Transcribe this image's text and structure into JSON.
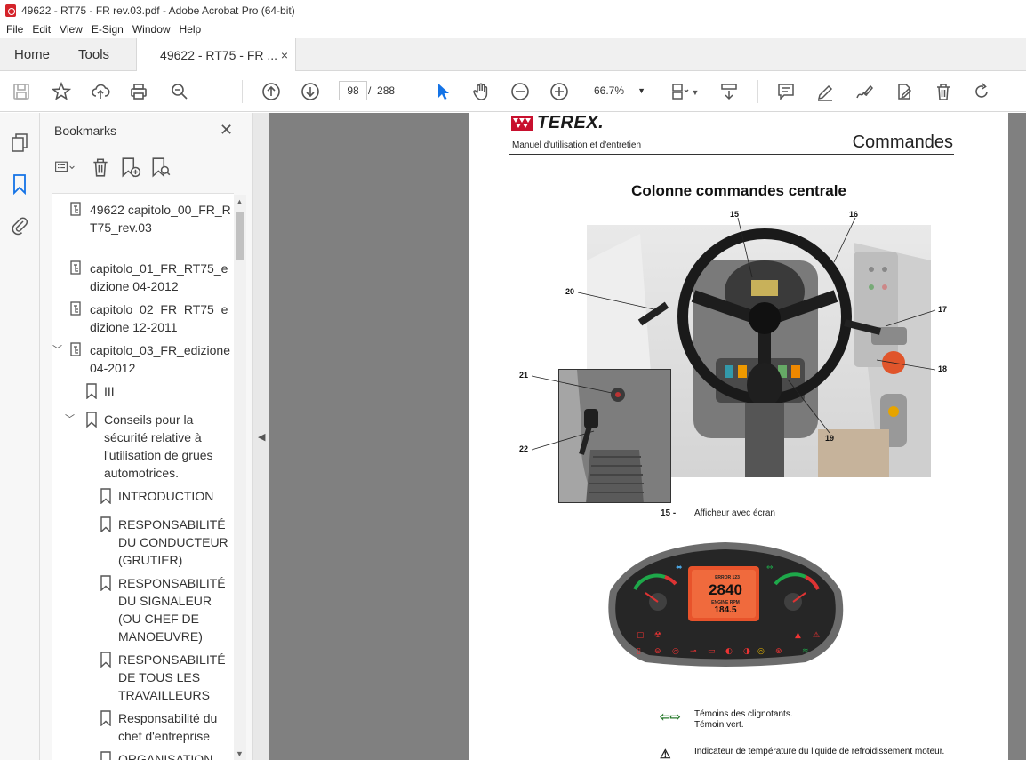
{
  "window": {
    "title": "49622 - RT75 - FR rev.03.pdf - Adobe Acrobat Pro (64-bit)"
  },
  "menu": [
    "File",
    "Edit",
    "View",
    "E-Sign",
    "Window",
    "Help"
  ],
  "tabs": {
    "home": "Home",
    "tools": "Tools",
    "document": "49622 - RT75 - FR ...",
    "close": "×"
  },
  "toolbar": {
    "page_current": "98",
    "page_separator": "/",
    "page_total": "288",
    "zoom": "66.7%"
  },
  "bookmarks": {
    "title": "Bookmarks",
    "close": "✕",
    "items": [
      {
        "label": "49622 capitolo_00_FR_RT75_rev.03"
      },
      {
        "label": "capitolo_01_FR_RT75_edizione 04-2012"
      },
      {
        "label": "capitolo_02_FR_RT75_edizione 12-2011"
      },
      {
        "label": "capitolo_03_FR_edizione 04-2012"
      },
      {
        "label": "III"
      },
      {
        "label": "Conseils pour la sécurité relative à l'utilisation  de grues automotrices."
      },
      {
        "label": "INTRODUCTION"
      },
      {
        "label": "RESPONSABILITÉ DU CONDUCTEUR (GRUTIER)"
      },
      {
        "label": "RESPONSABILITÉ DU SIGNALEUR (OU CHEF DE MANOEUVRE)"
      },
      {
        "label": "RESPONSABILITÉ DE TOUS LES TRAVAILLEURS"
      },
      {
        "label": "Responsabilité du chef d'entreprise"
      },
      {
        "label": "ORGANISATION"
      }
    ]
  },
  "document": {
    "brand": "TEREX.",
    "header_left": "Manuel d'utilisation et d'entretien",
    "header_right": "Commandes",
    "section_title": "Colonne commandes centrale",
    "callouts": [
      "15",
      "16",
      "17",
      "18",
      "19",
      "20",
      "21",
      "22"
    ],
    "caption_number": "15 -",
    "caption_text": "Afficheur avec écran",
    "display": {
      "error": "ERROR 123",
      "rpm": "2840",
      "rpm_label": "ENGINE RPM",
      "secondary": "184.5"
    },
    "legend": [
      {
        "text": "Témoins des clignotants.\nTémoin vert."
      },
      {
        "text": "Indicateur de température du liquide de refroidissement moteur."
      }
    ]
  }
}
